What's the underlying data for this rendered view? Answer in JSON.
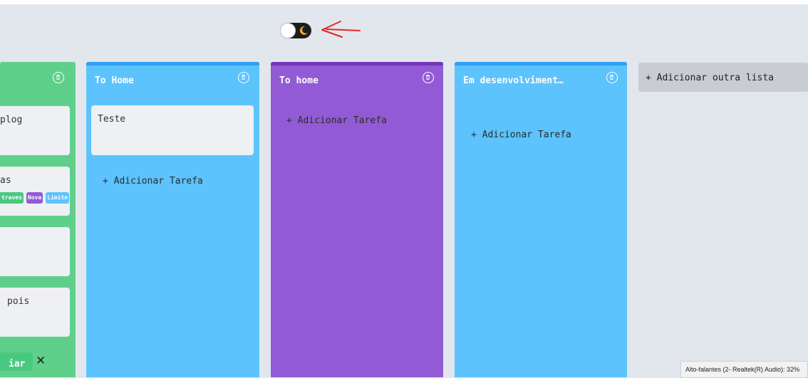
{
  "theme_toggle": {
    "knob_color": "#ffffff",
    "track_color": "#1d1d1d",
    "moon_color": "#f5a623"
  },
  "colors": {
    "green": "#5fd08a",
    "blue": "#5cc3fd",
    "purple": "#925bd5",
    "blue_bar": "#2e9ef5",
    "purple_bar": "#7436b8",
    "annotation": "#e6262b"
  },
  "lists": [
    {
      "title": "",
      "color": "#5fd08a",
      "cards": [
        {
          "text": "plog"
        },
        {
          "text": "as",
          "tags": [
            "traves",
            "Nova",
            "Limite"
          ]
        },
        {
          "text": ""
        },
        {
          "text": "pois"
        }
      ],
      "footer": {
        "button_label": "iar",
        "close_label": "✕"
      }
    },
    {
      "title": "To Home",
      "color": "#5cc3fd",
      "cards": [
        {
          "text": "Teste"
        }
      ],
      "add_task": "+ Adicionar Tarefa"
    },
    {
      "title": "To home",
      "color": "#925bd5",
      "cards": [],
      "add_task": "+ Adicionar Tarefa"
    },
    {
      "title": "Em desenvolviment…",
      "color": "#5cc3fd",
      "cards": [],
      "add_task": "+ Adicionar Tarefa"
    }
  ],
  "add_list": "+ Adicionar outra lista",
  "system_tooltip": "Alto-falantes (2- Realtek(R) Audio): 32%"
}
